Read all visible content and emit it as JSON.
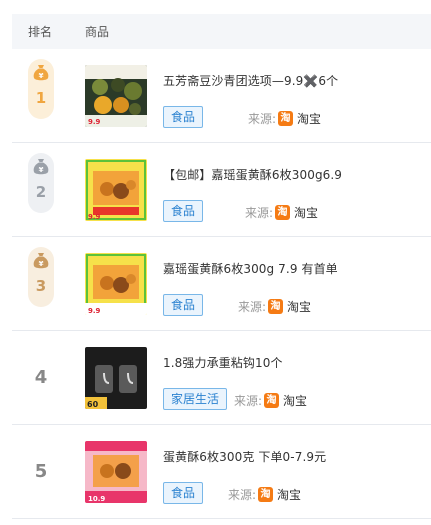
{
  "header": {
    "rank_label": "排名",
    "product_label": "商品"
  },
  "source_label": "来源:",
  "platform_icon": "淘",
  "rows": [
    {
      "rank": "1",
      "medal": "gold",
      "title": "五芳斋豆沙青团选项—9.9✖️6个",
      "tag": "食品",
      "platform": "淘宝"
    },
    {
      "rank": "2",
      "medal": "silver",
      "title": "【包邮】嘉瑶蛋黄酥6枚300g6.9",
      "tag": "食品",
      "platform": "淘宝"
    },
    {
      "rank": "3",
      "medal": "bronze",
      "title": "嘉瑶蛋黄酥6枚300g 7.9 有首单",
      "tag": "食品",
      "platform": "淘宝"
    },
    {
      "rank": "4",
      "medal": "none",
      "title": "1.8强力承重粘钩10个",
      "tag": "家居生活",
      "platform": "淘宝"
    },
    {
      "rank": "5",
      "medal": "none",
      "title": "蛋黄酥6枚300克 下单0-7.9元",
      "tag": "食品",
      "platform": "淘宝"
    }
  ],
  "thumb_texts": {
    "r1_price": "9.9",
    "r2_price": "9.9",
    "r3_price": "9.9",
    "r4_label": "60",
    "r5_price": "10.9"
  }
}
